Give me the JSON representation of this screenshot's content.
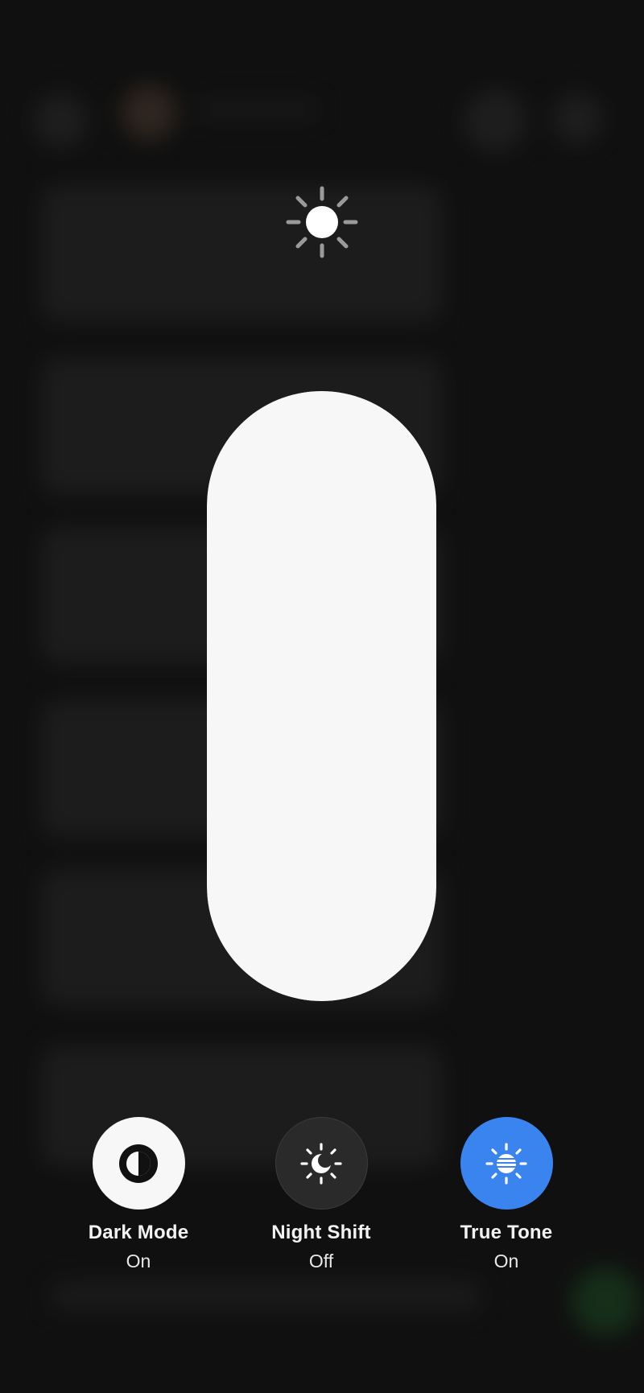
{
  "brightness": {
    "level": 1.0
  },
  "toggles": [
    {
      "label": "Dark Mode",
      "state": "On",
      "icon": "dark-mode-icon"
    },
    {
      "label": "Night Shift",
      "state": "Off",
      "icon": "night-shift-icon"
    },
    {
      "label": "True Tone",
      "state": "On",
      "icon": "true-tone-icon"
    }
  ],
  "colors": {
    "slider_fill": "#f7f7f7",
    "dark_mode_bg": "#f7f7f7",
    "night_shift_bg": "#2a2a2a",
    "true_tone_bg": "#3a84f0"
  }
}
